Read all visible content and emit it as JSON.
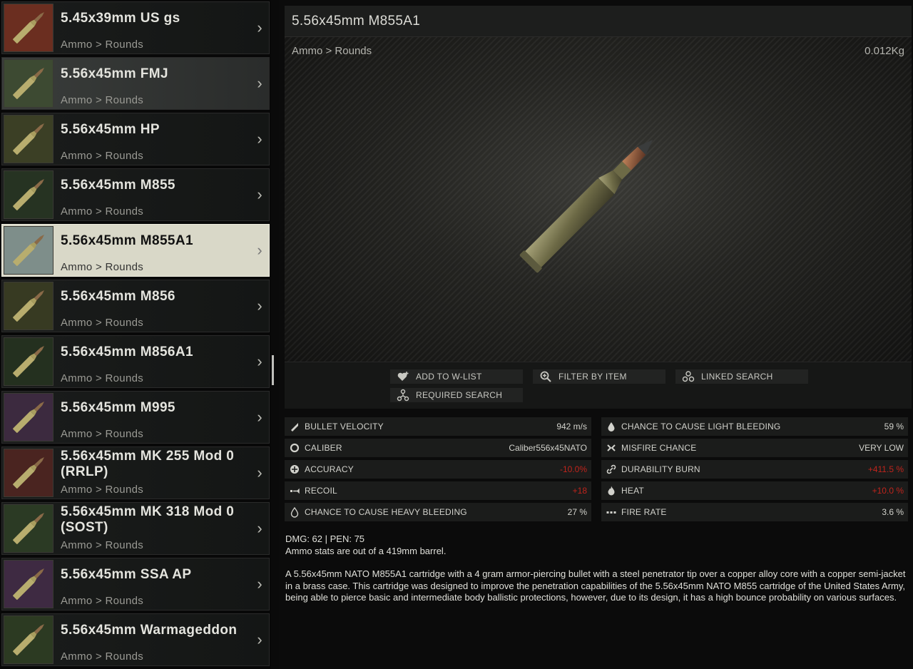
{
  "items": [
    {
      "name": "5.45x39mm US gs",
      "category": "Ammo > Rounds",
      "bg": "#6b2e20",
      "state": "normal"
    },
    {
      "name": "5.56x45mm FMJ",
      "category": "Ammo > Rounds",
      "bg": "#3d4a32",
      "state": "hover"
    },
    {
      "name": "5.56x45mm HP",
      "category": "Ammo > Rounds",
      "bg": "#3b3f25",
      "state": "normal"
    },
    {
      "name": "5.56x45mm M855",
      "category": "Ammo > Rounds",
      "bg": "#263322",
      "state": "normal"
    },
    {
      "name": "5.56x45mm M855A1",
      "category": "Ammo > Rounds",
      "bg": "#7e8e8a",
      "state": "selected"
    },
    {
      "name": "5.56x45mm M856",
      "category": "Ammo > Rounds",
      "bg": "#373a22",
      "state": "normal"
    },
    {
      "name": "5.56x45mm M856A1",
      "category": "Ammo > Rounds",
      "bg": "#24301f",
      "state": "normal"
    },
    {
      "name": "5.56x45mm M995",
      "category": "Ammo > Rounds",
      "bg": "#3c2a3f",
      "state": "normal"
    },
    {
      "name": "5.56x45mm MK 255 Mod 0 (RRLP)",
      "category": "Ammo > Rounds",
      "bg": "#4a2420",
      "state": "normal"
    },
    {
      "name": "5.56x45mm MK 318 Mod 0 (SOST)",
      "category": "Ammo > Rounds",
      "bg": "#2b3a24",
      "state": "normal"
    },
    {
      "name": "5.56x45mm SSA AP",
      "category": "Ammo > Rounds",
      "bg": "#3e2a42",
      "state": "normal"
    },
    {
      "name": "5.56x45mm Warmageddon",
      "category": "Ammo > Rounds",
      "bg": "#2c3a22",
      "state": "normal"
    }
  ],
  "detail": {
    "title": "5.56x45mm M855A1",
    "path": "Ammo > Rounds",
    "weight": "0.012Kg"
  },
  "actions": {
    "add_wishlist": "ADD TO W-LIST",
    "filter_by_item": "FILTER BY ITEM",
    "linked_search": "LINKED SEARCH",
    "required_search": "REQUIRED SEARCH"
  },
  "stats_left": [
    {
      "icon": "bullet-velocity-icon",
      "label": "BULLET VELOCITY",
      "value": "942 m/s",
      "negative": false
    },
    {
      "icon": "caliber-icon",
      "label": "CALIBER",
      "value": "Caliber556x45NATO",
      "negative": false
    },
    {
      "icon": "accuracy-icon",
      "label": "ACCURACY",
      "value": "-10.0%",
      "negative": true
    },
    {
      "icon": "recoil-icon",
      "label": "RECOIL",
      "value": "+18",
      "negative": true
    },
    {
      "icon": "heavy-bleeding-icon",
      "label": "CHANCE TO CAUSE HEAVY BLEEDING",
      "value": "27 %",
      "negative": false
    }
  ],
  "stats_right": [
    {
      "icon": "light-bleeding-icon",
      "label": "CHANCE TO CAUSE LIGHT BLEEDING",
      "value": "59 %",
      "negative": false
    },
    {
      "icon": "misfire-icon",
      "label": "MISFIRE CHANCE",
      "value": "VERY LOW",
      "negative": false
    },
    {
      "icon": "durability-burn-icon",
      "label": "DURABILITY BURN",
      "value": "+411.5 %",
      "negative": true
    },
    {
      "icon": "heat-icon",
      "label": "HEAT",
      "value": "+10.0 %",
      "negative": true
    },
    {
      "icon": "fire-rate-icon",
      "label": "FIRE RATE",
      "value": "3.6 %",
      "negative": false
    }
  ],
  "description": {
    "line1": "DMG: 62 | PEN: 75",
    "line2": "Ammo stats are out of a 419mm barrel.",
    "body": "A 5.56x45mm NATO M855A1 cartridge with a 4 gram armor-piercing bullet with a steel penetrator tip over a copper alloy core with a copper semi-jacket in a brass case. This cartridge was designed to improve the penetration capabilities of the 5.56x45mm NATO M855 cartridge of the United States Army, being able to pierce basic and intermediate body ballistic protections, however, due to its design, it has a high bounce probability on various surfaces."
  }
}
